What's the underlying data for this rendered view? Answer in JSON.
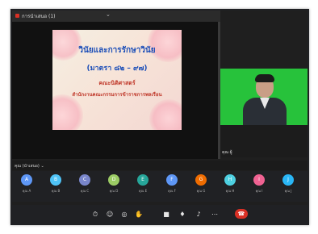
{
  "share": {
    "tab_title": "การนำเสนอ (1)",
    "chevron_icon": "chevron-down-icon"
  },
  "slide": {
    "title": "วินัยและการรักษาวินัย",
    "subtitle": "(มาตรา ๘๒ – ๙๗)",
    "line1": "คณะนิติศาสตร์",
    "line2": "สำนักงานคณะกรรมการข้าราชการพลเรือน"
  },
  "speaker": {
    "name": "คุณ ผู้"
  },
  "presenter": {
    "label": "คุณ (นำเสนอ) ⌄"
  },
  "participants": [
    {
      "initial": "A",
      "name": "คุณ A",
      "color": "#5e97f6"
    },
    {
      "initial": "B",
      "name": "คุณ B",
      "color": "#4fc3f7"
    },
    {
      "initial": "C",
      "name": "คุณ C",
      "color": "#7986cb"
    },
    {
      "initial": "D",
      "name": "คุณ D",
      "color": "#9ccc65"
    },
    {
      "initial": "E",
      "name": "คุณ E",
      "color": "#26a69a"
    },
    {
      "initial": "F",
      "name": "คุณ F",
      "color": "#5e97f6"
    },
    {
      "initial": "G",
      "name": "คุณ G",
      "color": "#ef6c00"
    },
    {
      "initial": "H",
      "name": "คุณ H",
      "color": "#4dd0e1"
    },
    {
      "initial": "I",
      "name": "คุณ I",
      "color": "#f06292"
    },
    {
      "initial": "J",
      "name": "คุณ J",
      "color": "#29b6f6"
    }
  ],
  "controls": {
    "buttons": [
      "captions-icon",
      "people-icon",
      "record-icon",
      "hand-icon",
      "camera-icon",
      "mic-icon",
      "volume-icon",
      "more-icon"
    ],
    "end_call": "end-call-icon"
  },
  "colors": {
    "green_screen": "#27c23b",
    "end_call": "#d93025",
    "slide_title": "#1d4fb8",
    "slide_accent": "#c0392b"
  }
}
